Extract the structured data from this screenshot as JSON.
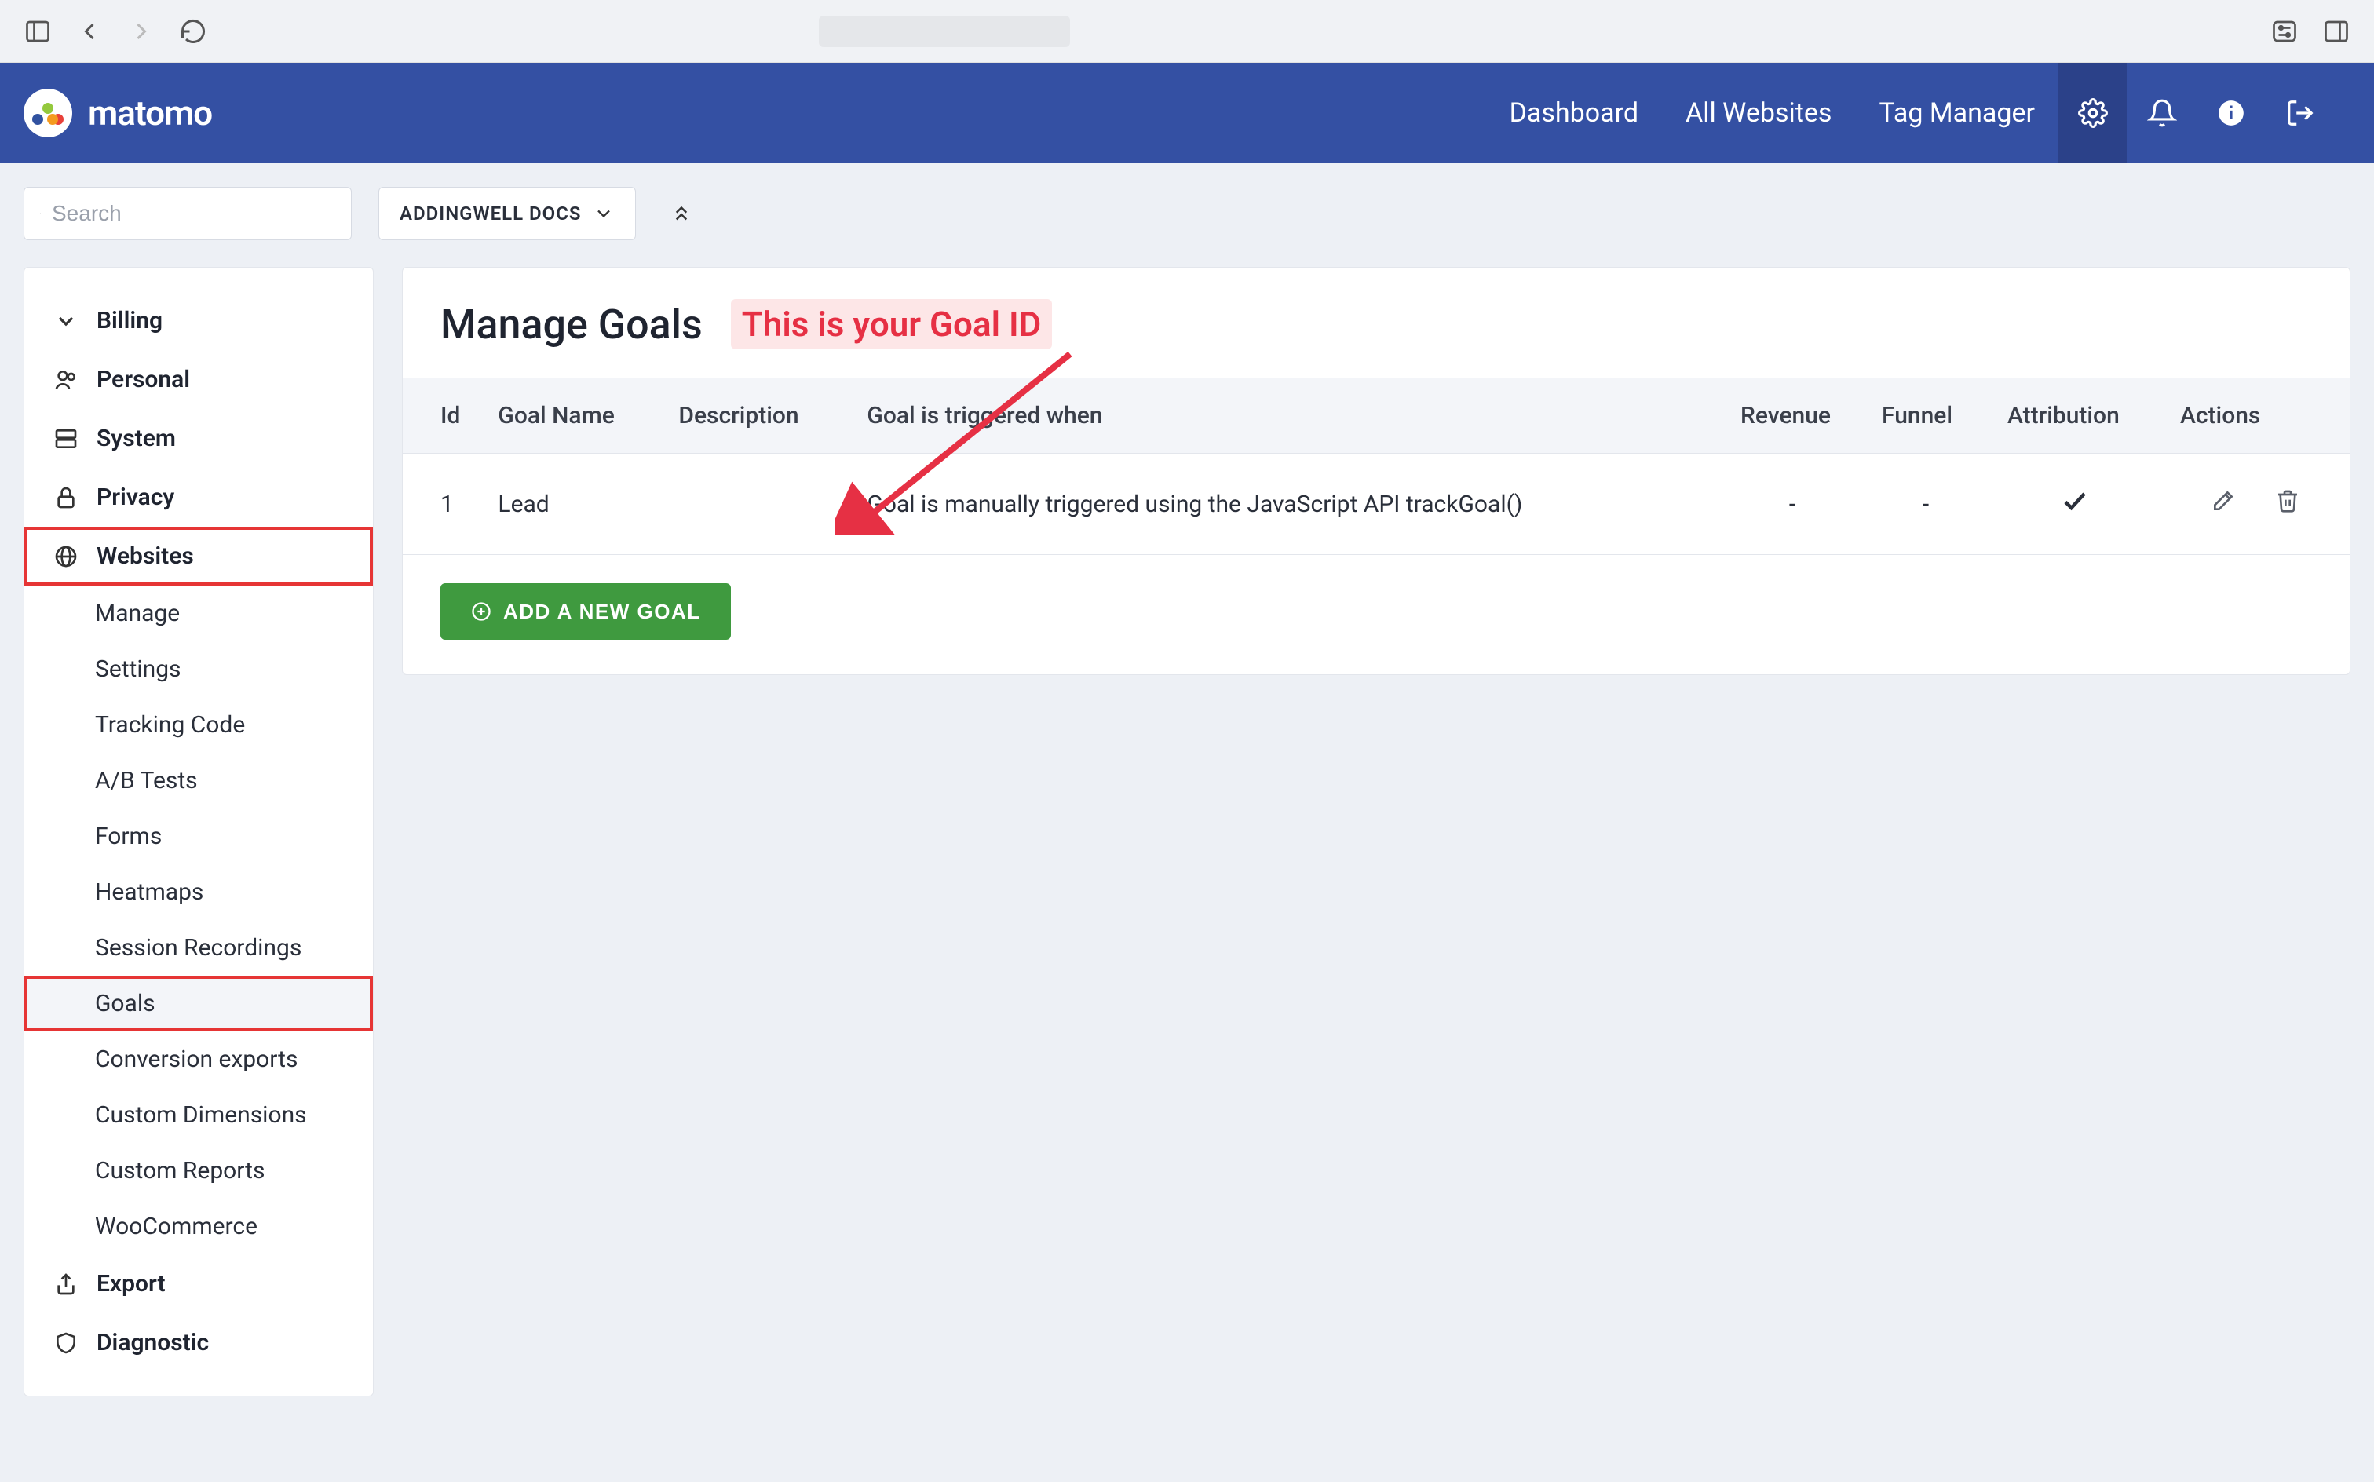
{
  "browser": {
    "icons": {
      "sidebar": "sidebar-icon",
      "back": "back-icon",
      "forward": "forward-icon",
      "reload": "reload-icon",
      "toggles": "toggles-icon",
      "panel": "panel-icon"
    }
  },
  "brand": {
    "name": "matomo"
  },
  "header": {
    "nav": {
      "dashboard": "Dashboard",
      "all_websites": "All Websites",
      "tag_manager": "Tag Manager"
    }
  },
  "subheader": {
    "search_placeholder": "Search",
    "site_selector": "ADDINGWELL DOCS"
  },
  "sidebar": {
    "sections": {
      "billing": "Billing",
      "personal": "Personal",
      "system": "System",
      "privacy": "Privacy",
      "websites": "Websites",
      "export": "Export",
      "diagnostic": "Diagnostic"
    },
    "websites_children": {
      "manage": "Manage",
      "settings": "Settings",
      "tracking_code": "Tracking Code",
      "ab_tests": "A/B Tests",
      "forms": "Forms",
      "heatmaps": "Heatmaps",
      "session_recordings": "Session Recordings",
      "goals": "Goals",
      "conversion_exports": "Conversion exports",
      "custom_dimensions": "Custom Dimensions",
      "custom_reports": "Custom Reports",
      "woocommerce": "WooCommerce"
    }
  },
  "main": {
    "title": "Manage Goals",
    "callout": "This is your Goal ID",
    "table": {
      "headers": {
        "id": "Id",
        "name": "Goal Name",
        "description": "Description",
        "triggered": "Goal is triggered when",
        "revenue": "Revenue",
        "funnel": "Funnel",
        "attribution": "Attribution",
        "actions": "Actions"
      },
      "rows": [
        {
          "id": "1",
          "name": "Lead",
          "description": "",
          "triggered": "Goal is manually triggered using the JavaScript API trackGoal()",
          "revenue": "-",
          "funnel": "-",
          "attribution_check": true
        }
      ]
    },
    "add_button": "ADD A NEW GOAL"
  }
}
